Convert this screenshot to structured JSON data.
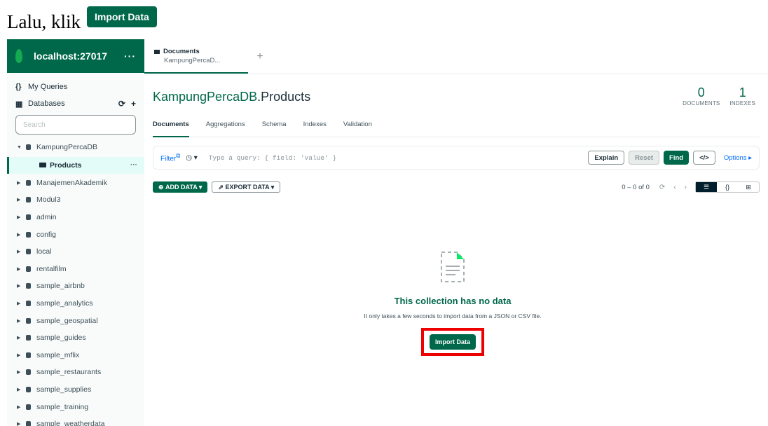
{
  "caption": {
    "text": "Lalu, klik",
    "button_label": "Import Data"
  },
  "sidebar": {
    "connection": {
      "name": "localhost:27017",
      "more": "···"
    },
    "my_queries": {
      "icon": "{}",
      "label": "My Queries"
    },
    "databases": {
      "label": "Databases",
      "refresh": "⟳",
      "add": "+"
    },
    "search_placeholder": "Search",
    "items": [
      {
        "name": "KampungPercaDB",
        "expanded": true
      },
      {
        "name": "ManajemenAkademik"
      },
      {
        "name": "Modul3"
      },
      {
        "name": "admin"
      },
      {
        "name": "config"
      },
      {
        "name": "local"
      },
      {
        "name": "rentalfilm"
      },
      {
        "name": "sample_airbnb"
      },
      {
        "name": "sample_analytics"
      },
      {
        "name": "sample_geospatial"
      },
      {
        "name": "sample_guides"
      },
      {
        "name": "sample_mflix"
      },
      {
        "name": "sample_restaurants"
      },
      {
        "name": "sample_supplies"
      },
      {
        "name": "sample_training"
      },
      {
        "name": "sample_weatherdata"
      }
    ],
    "collection": {
      "name": "Products",
      "more": "···"
    }
  },
  "tab": {
    "title": "Documents",
    "subtitle": "KampungPercaD...",
    "add": "+"
  },
  "header": {
    "db": "KampungPercaDB",
    "coll": ".Products",
    "documents_count": "0",
    "documents_label": "DOCUMENTS",
    "indexes_count": "1",
    "indexes_label": "INDEXES"
  },
  "subtabs": [
    "Documents",
    "Aggregations",
    "Schema",
    "Indexes",
    "Validation"
  ],
  "query": {
    "filter_label": "Filter",
    "placeholder": "Type a query: { field: 'value' }",
    "explain": "Explain",
    "reset": "Reset",
    "find": "Find",
    "code": "</>",
    "options": "Options ▸"
  },
  "actions": {
    "add_data": "ADD DATA ▾",
    "export_data": "EXPORT DATA ▾",
    "pagination": "0 – 0 of 0",
    "view_list": "☰",
    "view_json": "{}",
    "view_table": "⊞"
  },
  "empty": {
    "title": "This collection has no data",
    "desc": "It only takes a few seconds to import data from a JSON or CSV file.",
    "button": "Import Data"
  },
  "colors": {
    "accent": "#00684a",
    "highlight": "#ee0000",
    "link": "#016bf8"
  }
}
